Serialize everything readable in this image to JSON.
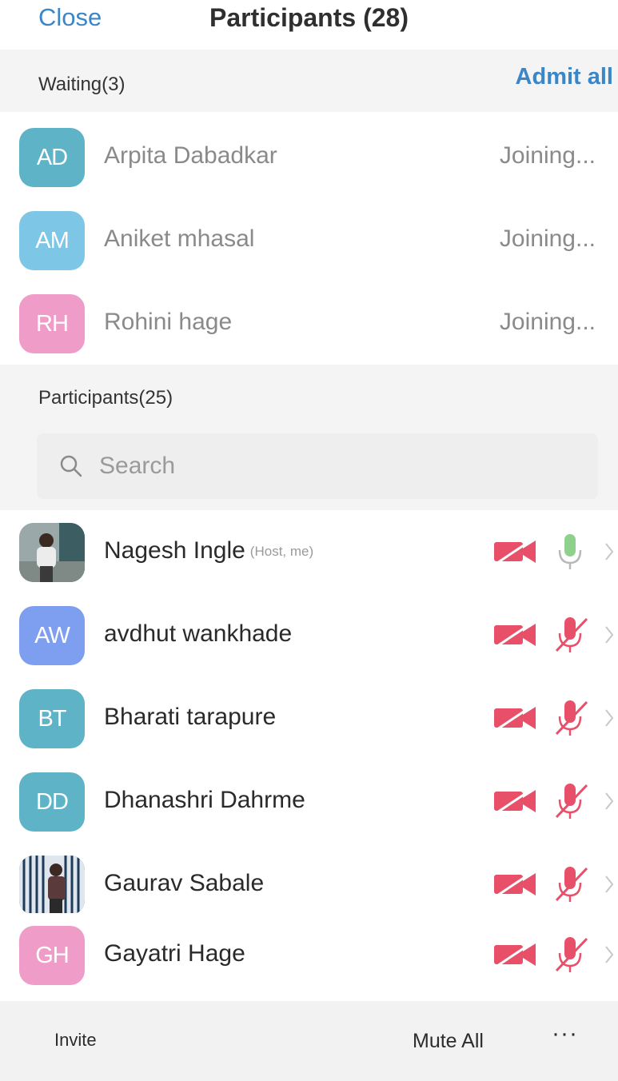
{
  "header": {
    "close_label": "Close",
    "title": "Participants (28)"
  },
  "waiting": {
    "label": "Waiting(3)",
    "admit_all_label": "Admit all",
    "items": [
      {
        "initials": "AD",
        "name": "Arpita Dabadkar",
        "status": "Joining...",
        "color": "#5fb3c6"
      },
      {
        "initials": "AM",
        "name": "Aniket mhasal",
        "status": "Joining...",
        "color": "#7ec6e6"
      },
      {
        "initials": "RH",
        "name": "Rohini hage",
        "status": "Joining...",
        "color": "#f09cc8"
      }
    ]
  },
  "participants": {
    "label": "Participants(25)",
    "search_placeholder": "Search",
    "items": [
      {
        "initials": "",
        "name": "Nagesh Ingle",
        "role": "(Host, me)",
        "avatar": "photo",
        "video": "off",
        "mic": "on"
      },
      {
        "initials": "AW",
        "name": "avdhut wankhade",
        "color": "#7e9ef0",
        "video": "off",
        "mic": "muted"
      },
      {
        "initials": "BT",
        "name": "Bharati tarapure",
        "color": "#5fb3c6",
        "video": "off",
        "mic": "muted"
      },
      {
        "initials": "DD",
        "name": "Dhanashri Dahrme",
        "color": "#5fb3c6",
        "video": "off",
        "mic": "muted"
      },
      {
        "initials": "",
        "name": "Gaurav Sabale",
        "avatar": "photo",
        "video": "off",
        "mic": "muted"
      },
      {
        "initials": "GH",
        "name": "Gayatri Hage",
        "color": "#f09cc8",
        "video": "off",
        "mic": "muted"
      }
    ]
  },
  "footer": {
    "invite_label": "Invite",
    "mute_all_label": "Mute All",
    "more_label": "···"
  },
  "colors": {
    "accent": "#3b86c7",
    "muted_red": "#e8506a",
    "mic_green": "#8fd18c"
  }
}
